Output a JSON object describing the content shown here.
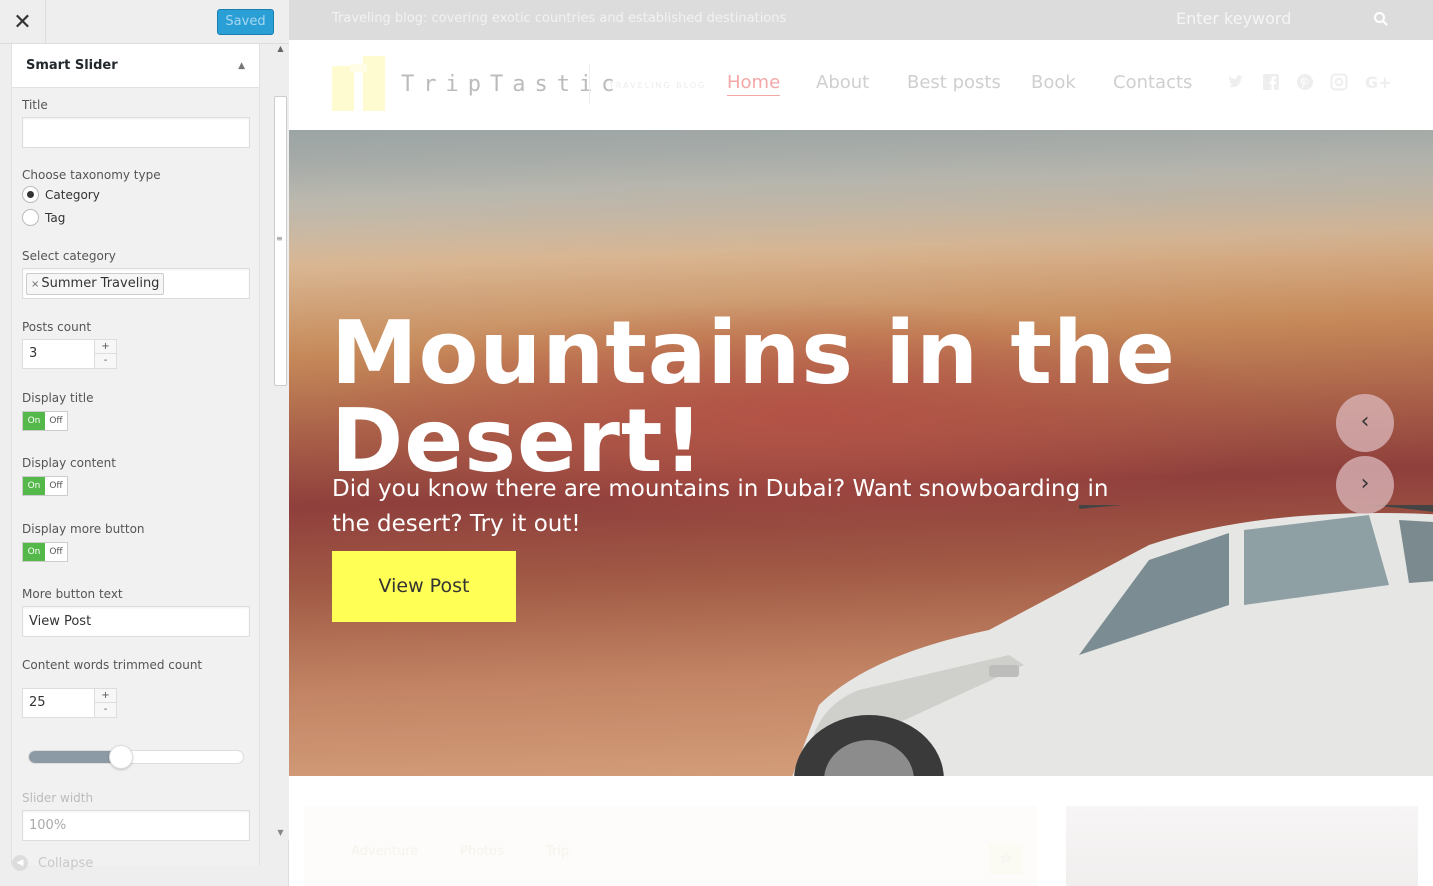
{
  "panel": {
    "close_glyph": "✕",
    "saved_label": "Saved",
    "section_title": "Smart Slider",
    "title_label": "Title",
    "title_value": "",
    "taxonomy_label": "Choose taxonomy type",
    "taxonomy_options": [
      "Category",
      "Tag"
    ],
    "taxonomy_selected": "Category",
    "category_label": "Select category",
    "category_value": "Summer Traveling",
    "posts_count_label": "Posts count",
    "posts_count_value": "3",
    "display_title_label": "Display title",
    "display_content_label": "Display content",
    "display_more_label": "Display more button",
    "toggle_on": "On",
    "toggle_off": "Off",
    "more_text_label": "More button text",
    "more_text_value": "View Post",
    "trim_label": "Content words trimmed count",
    "trim_value": "25",
    "trim_slider_fraction": 0.43,
    "width_label": "Slider width",
    "width_value": "100%",
    "collapse_label": "Collapse",
    "spin_up": "+",
    "spin_down": "-"
  },
  "site": {
    "tagline": "Traveling blog: covering exotic countries and established destinations",
    "search_placeholder": "Enter keyword",
    "logo_text": "TripTastic",
    "logo_sub": "TRAVELING BLOG",
    "nav": [
      "Home",
      "About",
      "Best posts",
      "Book",
      "Contacts"
    ],
    "nav_active": "Home",
    "social_icons": [
      "twitter-icon",
      "facebook-icon",
      "pinterest-icon",
      "instagram-icon",
      "google-plus-icon"
    ]
  },
  "hero": {
    "title": "Mountains in the Desert!",
    "text": "Did you know there are mountains in Dubai? Want snowboarding in the desert? Try it out!",
    "button": "View Post",
    "prev_glyph": "‹",
    "next_glyph": "›"
  },
  "cards": {
    "tags": [
      "Adventure",
      "Photos",
      "Trip"
    ],
    "star_glyph": "☆"
  },
  "colors": {
    "accent_blue": "#2a9fd6",
    "toggle_green": "#54b84a",
    "cta_yellow": "#ffff55",
    "nav_active": "#f3a7a7"
  }
}
